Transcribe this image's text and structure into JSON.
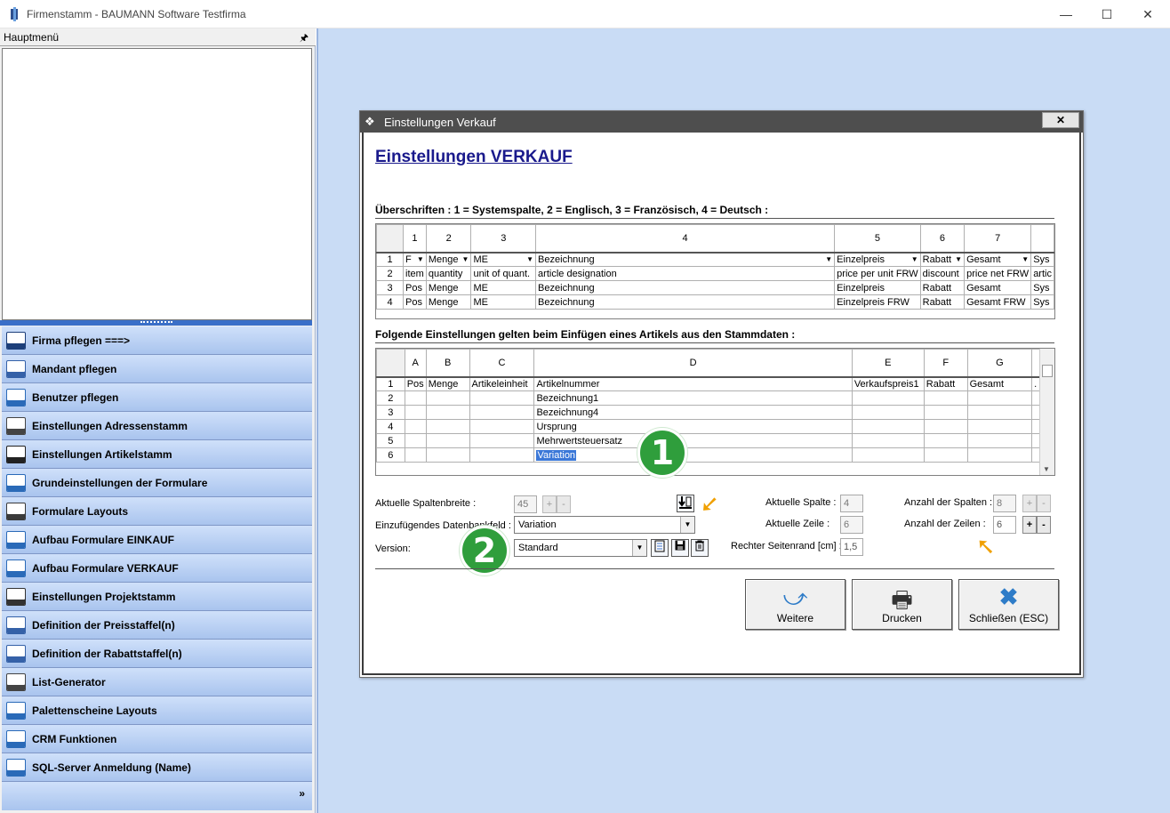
{
  "window": {
    "title": "Firmenstamm - BAUMANN Software Testfirma",
    "controls": {
      "minimize": "—",
      "maximize": "☐",
      "close": "✕"
    }
  },
  "left_panel": {
    "header": "Hauptmenü",
    "pin": "ᵖ",
    "menu": [
      {
        "label": "Firma pflegen   ===>",
        "icon": "factory-icon"
      },
      {
        "label": "Mandant pflegen",
        "icon": "mandant-icon"
      },
      {
        "label": "Benutzer pflegen",
        "icon": "users-icon"
      },
      {
        "label": "Einstellungen Adressenstamm",
        "icon": "address-card-icon"
      },
      {
        "label": "Einstellungen Artikelstamm",
        "icon": "barcode-scanner-icon"
      },
      {
        "label": "Grundeinstellungen der Formulare",
        "icon": "form-settings-icon"
      },
      {
        "label": "Formulare Layouts",
        "icon": "layout-icon"
      },
      {
        "label": "Aufbau Formulare EINKAUF",
        "icon": "download-tray-icon"
      },
      {
        "label": "Aufbau Formulare VERKAUF",
        "icon": "upload-tray-icon"
      },
      {
        "label": "Einstellungen Projektstamm",
        "icon": "project-icon"
      },
      {
        "label": "Definition der Preisstaffel(n)",
        "icon": "price-scale-icon"
      },
      {
        "label": "Definition der Rabattstaffel(n)",
        "icon": "discount-icon"
      },
      {
        "label": "List-Generator",
        "icon": "list-icon"
      },
      {
        "label": "Palettenscheine Layouts",
        "icon": "pallet-icon"
      },
      {
        "label": "CRM Funktionen",
        "icon": "crm-icon"
      },
      {
        "label": "SQL-Server Anmeldung (Name)",
        "icon": "sql-server-icon"
      }
    ],
    "footer_chevron": "»"
  },
  "dialog": {
    "title": "Einstellungen Verkauf",
    "close": "✕",
    "heading": "Einstellungen VERKAUF",
    "section1": "Überschriften : 1 = Systemspalte, 2 = Englisch, 3 = Französisch, 4 = Deutsch :",
    "grid1": {
      "headers": [
        "",
        "1",
        "2",
        "3",
        "4",
        "5",
        "6",
        "7",
        ""
      ],
      "rows": [
        [
          "1",
          "F",
          "Menge",
          "ME",
          "Bezeichnung",
          "Einzelpreis",
          "Rabatt",
          "Gesamt",
          "Sys"
        ],
        [
          "2",
          "item",
          "quantity",
          "unit of quant.",
          "article designation",
          "price per unit FRW",
          "discount",
          "price net FRW",
          "artic"
        ],
        [
          "3",
          "Pos",
          "Menge",
          "ME",
          "Bezeichnung",
          "Einzelpreis",
          "Rabatt",
          "Gesamt",
          "Sys"
        ],
        [
          "4",
          "Pos",
          "Menge",
          "ME",
          "Bezeichnung",
          "Einzelpreis FRW",
          "Rabatt",
          "Gesamt FRW",
          "Sys"
        ]
      ]
    },
    "section2": "Folgende Einstellungen gelten beim Einfügen eines Artikels aus den Stammdaten :",
    "grid2": {
      "headers": [
        "",
        "A",
        "B",
        "C",
        "D",
        "E",
        "F",
        "G",
        ""
      ],
      "rows": [
        [
          "1",
          "Pos",
          "Menge",
          "Artikeleinheit",
          "Artikelnummer",
          "Verkaufspreis1",
          "Rabatt",
          "Gesamt",
          "."
        ],
        [
          "2",
          "",
          "",
          "",
          "Bezeichnung1",
          "",
          "",
          "",
          ""
        ],
        [
          "3",
          "",
          "",
          "",
          "Bezeichnung4",
          "",
          "",
          "",
          ""
        ],
        [
          "4",
          "",
          "",
          "",
          "Ursprung",
          "",
          "",
          "",
          ""
        ],
        [
          "5",
          "",
          "",
          "",
          "Mehrwertsteuersatz",
          "",
          "",
          "",
          ""
        ],
        [
          "6",
          "",
          "",
          "",
          "Variation",
          "",
          "",
          "",
          ""
        ]
      ]
    },
    "badge1": "1",
    "badge2": "2",
    "fields": {
      "spaltenbreite_label": "Aktuelle Spaltenbreite :",
      "spaltenbreite_value": "45",
      "datenbankfeld_label": "Einzufügendes Datenbankfeld :",
      "datenbankfeld_value": "Variation",
      "version_label": "Version:",
      "version_value": "Standard",
      "akt_spalte_label": "Aktuelle Spalte :",
      "akt_spalte_value": "4",
      "akt_zeile_label": "Aktuelle Zeile :",
      "akt_zeile_value": "6",
      "seitenrand_label": "Rechter Seitenrand [cm] :",
      "seitenrand_value": "1,5",
      "anz_spalten_label": "Anzahl der Spalten :",
      "anz_spalten_value": "8",
      "anz_zeilen_label": "Anzahl der Zeilen :",
      "anz_zeilen_value": "6",
      "plus": "+",
      "minus": "-"
    },
    "buttons": {
      "weitere": "Weitere",
      "drucken": "Drucken",
      "schliessen": "Schließen (ESC)"
    }
  }
}
